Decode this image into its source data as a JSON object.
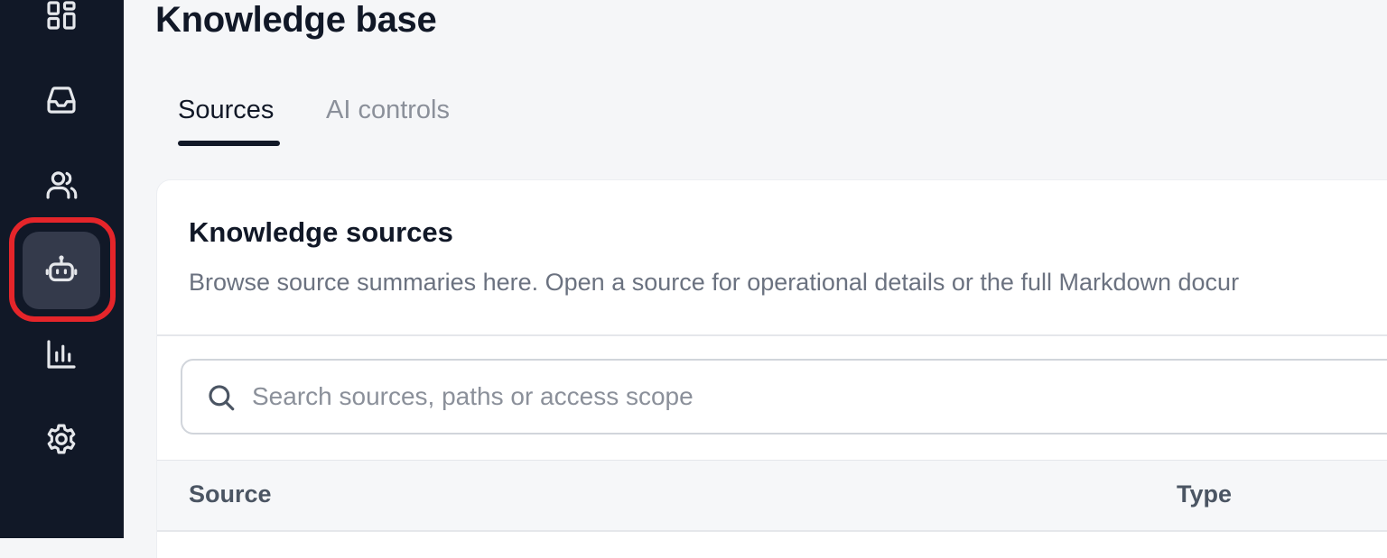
{
  "sidebar": {
    "items": [
      {
        "icon": "dashboard-icon",
        "label": "Dashboard"
      },
      {
        "icon": "inbox-icon",
        "label": "Inbox"
      },
      {
        "icon": "users-icon",
        "label": "Contacts"
      },
      {
        "icon": "bot-icon",
        "label": "AI agent",
        "active": true
      },
      {
        "icon": "bar-chart-icon",
        "label": "Reports"
      },
      {
        "icon": "gear-icon",
        "label": "Settings"
      }
    ],
    "highlight_color": "#e5252a"
  },
  "header": {
    "title": "Knowledge base"
  },
  "tabs": [
    {
      "label": "Sources",
      "active": true
    },
    {
      "label": "AI controls",
      "active": false
    }
  ],
  "card": {
    "title": "Knowledge sources",
    "description": "Browse source summaries here. Open a source for operational details or the full Markdown docur",
    "search": {
      "placeholder": "Search sources, paths or access scope",
      "value": ""
    },
    "table": {
      "columns": [
        "Source",
        "Type"
      ]
    }
  },
  "colors": {
    "sidebar_bg": "#111827",
    "page_bg": "#f5f6f8",
    "active_nav_bg": "#343a4b",
    "primary_text": "#111827",
    "muted_text": "#8b909a"
  }
}
